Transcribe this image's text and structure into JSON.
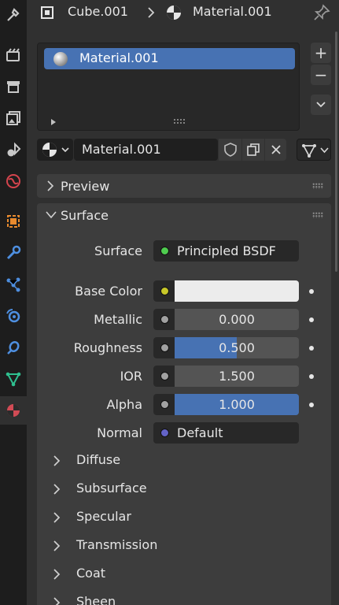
{
  "header": {
    "object_name": "Cube.001",
    "material_name": "Material.001"
  },
  "slot_list": {
    "items": [
      {
        "label": "Material.001"
      }
    ],
    "add_label": "+",
    "remove_label": "−"
  },
  "datablock": {
    "name": "Material.001"
  },
  "panels": {
    "preview": "Preview",
    "surface": "Surface"
  },
  "surface": {
    "shader_label": "Surface",
    "shader_value": "Principled BSDF",
    "shader_color": "#4fcc4f",
    "properties": [
      {
        "label": "Base Color",
        "kind": "color",
        "value": "",
        "socket_color": "#c7c729",
        "swatch": "#ececec"
      },
      {
        "label": "Metallic",
        "kind": "value",
        "value": "0.000",
        "fraction": 0.0,
        "socket_color": "#a1a1a1"
      },
      {
        "label": "Roughness",
        "kind": "value",
        "value": "0.500",
        "fraction": 0.5,
        "socket_color": "#a1a1a1"
      },
      {
        "label": "IOR",
        "kind": "value",
        "value": "1.500",
        "fraction": 0.0,
        "socket_color": "#a1a1a1"
      },
      {
        "label": "Alpha",
        "kind": "value",
        "value": "1.000",
        "fraction": 1.0,
        "socket_color": "#a1a1a1"
      }
    ],
    "normal_label": "Normal",
    "normal_value": "Default",
    "normal_color": "#6363c7",
    "subpanels": [
      "Diffuse",
      "Subsurface",
      "Specular",
      "Transmission",
      "Coat",
      "Sheen"
    ]
  },
  "colors": {
    "accent": "#4772b3",
    "panel": "#3d3d3d",
    "background": "#303030",
    "sidebar": "#1d1d1d"
  },
  "tab_icons": [
    "tool-icon",
    "render-icon",
    "output-icon",
    "view-layer-icon",
    "scene-icon",
    "world-icon",
    "object-icon",
    "modifier-icon",
    "particles-icon",
    "physics-icon",
    "constraints-icon",
    "data-icon",
    "material-icon"
  ]
}
